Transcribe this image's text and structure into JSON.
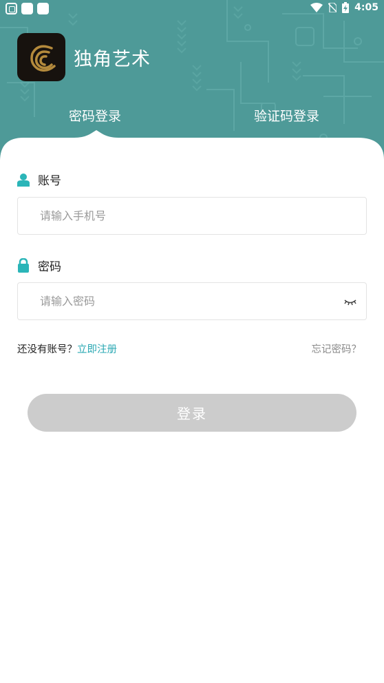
{
  "status_bar": {
    "time": "4:05"
  },
  "app": {
    "name": "独角艺术",
    "logo_icon": "unicorn-logo-icon"
  },
  "tabs": [
    {
      "label": "密码登录",
      "active": true
    },
    {
      "label": "验证码登录",
      "active": false
    }
  ],
  "form": {
    "account": {
      "label": "账号",
      "placeholder": "请输入手机号",
      "value": ""
    },
    "password": {
      "label": "密码",
      "placeholder": "请输入密码",
      "value": ""
    }
  },
  "links": {
    "no_account": "还没有账号？",
    "register": "立即注册",
    "forgot": "忘记密码？"
  },
  "login_button": {
    "label": "登录",
    "enabled": false
  },
  "colors": {
    "header_bg": "#4e9a98",
    "accent": "#2aa8b3",
    "button_disabled": "#cccccc"
  }
}
